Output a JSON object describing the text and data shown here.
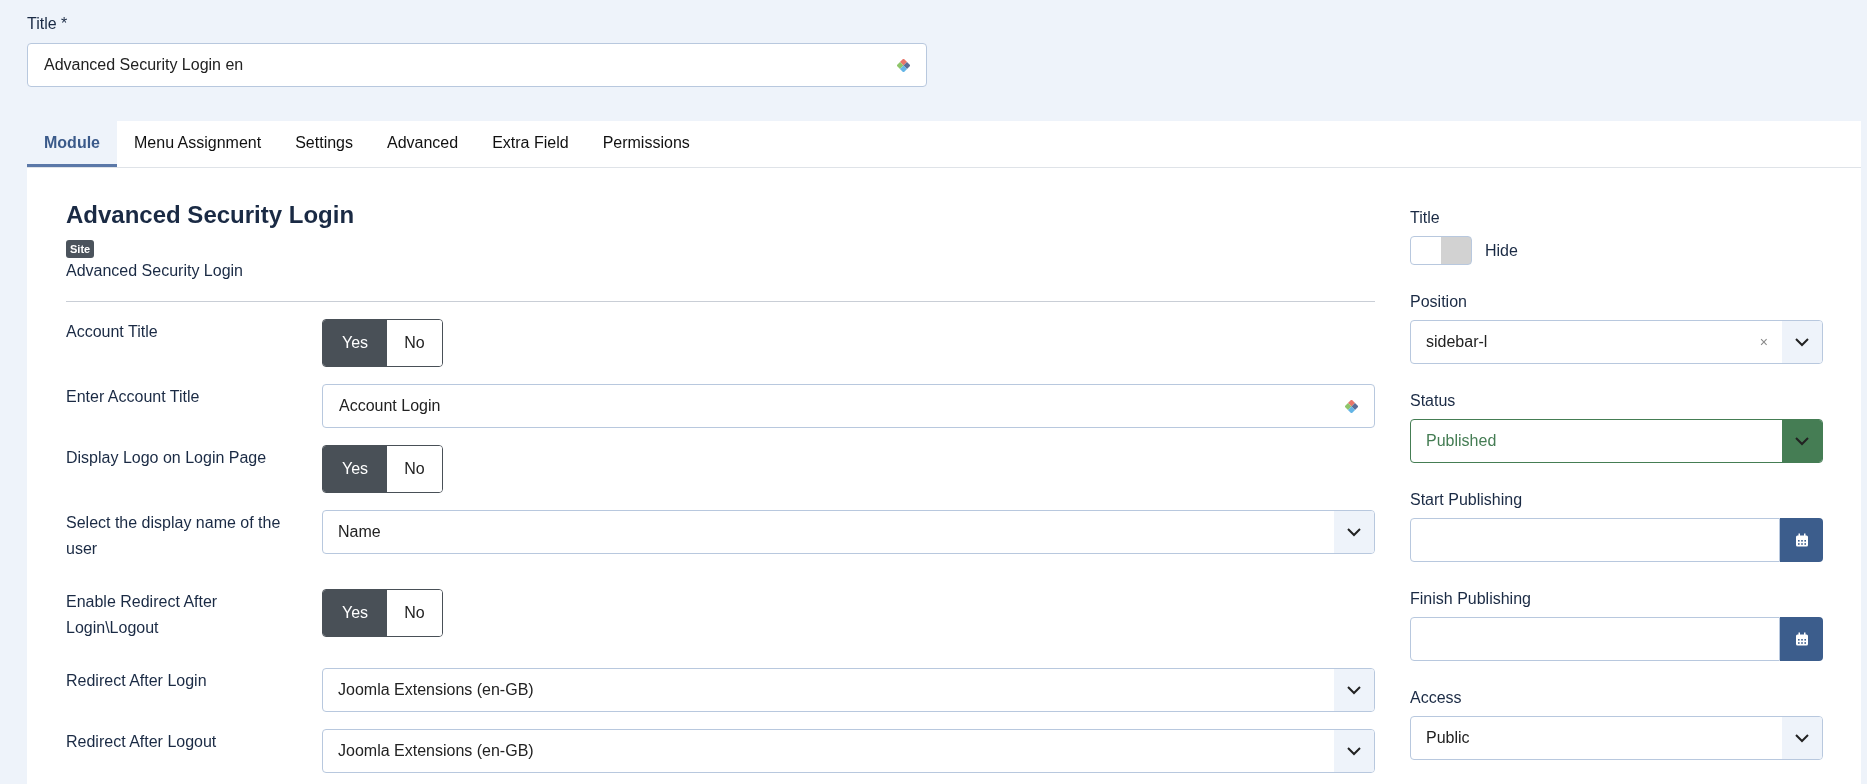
{
  "title_field": {
    "label": "Title *",
    "value": "Advanced Security Login en"
  },
  "tabs": [
    {
      "label": "Module",
      "selected": true
    },
    {
      "label": "Menu Assignment",
      "selected": false
    },
    {
      "label": "Settings",
      "selected": false
    },
    {
      "label": "Advanced",
      "selected": false
    },
    {
      "label": "Extra Field",
      "selected": false
    },
    {
      "label": "Permissions",
      "selected": false
    }
  ],
  "module": {
    "heading": "Advanced Security Login",
    "badge": "Site",
    "description": "Advanced Security Login"
  },
  "fields": [
    {
      "kind": "toggle",
      "label": "Account Title",
      "options": [
        {
          "label": "Yes",
          "selected": true
        },
        {
          "label": "No",
          "selected": false
        }
      ]
    },
    {
      "kind": "text",
      "label": "Enter Account Title",
      "value": "Account Login"
    },
    {
      "kind": "toggle",
      "label": "Display Logo on Login Page",
      "options": [
        {
          "label": "Yes",
          "selected": true
        },
        {
          "label": "No",
          "selected": false
        }
      ]
    },
    {
      "kind": "select",
      "label": "Select the display name of the user",
      "value": "Name"
    },
    {
      "kind": "toggle",
      "label": "Enable Redirect After Login\\Logout",
      "options": [
        {
          "label": "Yes",
          "selected": true
        },
        {
          "label": "No",
          "selected": false
        }
      ]
    },
    {
      "kind": "select",
      "label": "Redirect After Login",
      "value": "Joomla Extensions (en-GB)"
    },
    {
      "kind": "select",
      "label": "Redirect After Logout",
      "value": "Joomla Extensions (en-GB)"
    }
  ],
  "sidebar": [
    {
      "kind": "switch",
      "label": "Title",
      "state_label": "Hide",
      "on": false
    },
    {
      "kind": "select",
      "label": "Position",
      "value": "sidebar-l",
      "clear": "×"
    },
    {
      "kind": "status",
      "label": "Status",
      "value": "Published"
    },
    {
      "kind": "date",
      "label": "Start Publishing"
    },
    {
      "kind": "date",
      "label": "Finish Publishing"
    },
    {
      "kind": "select",
      "label": "Access",
      "value": "Public"
    }
  ]
}
